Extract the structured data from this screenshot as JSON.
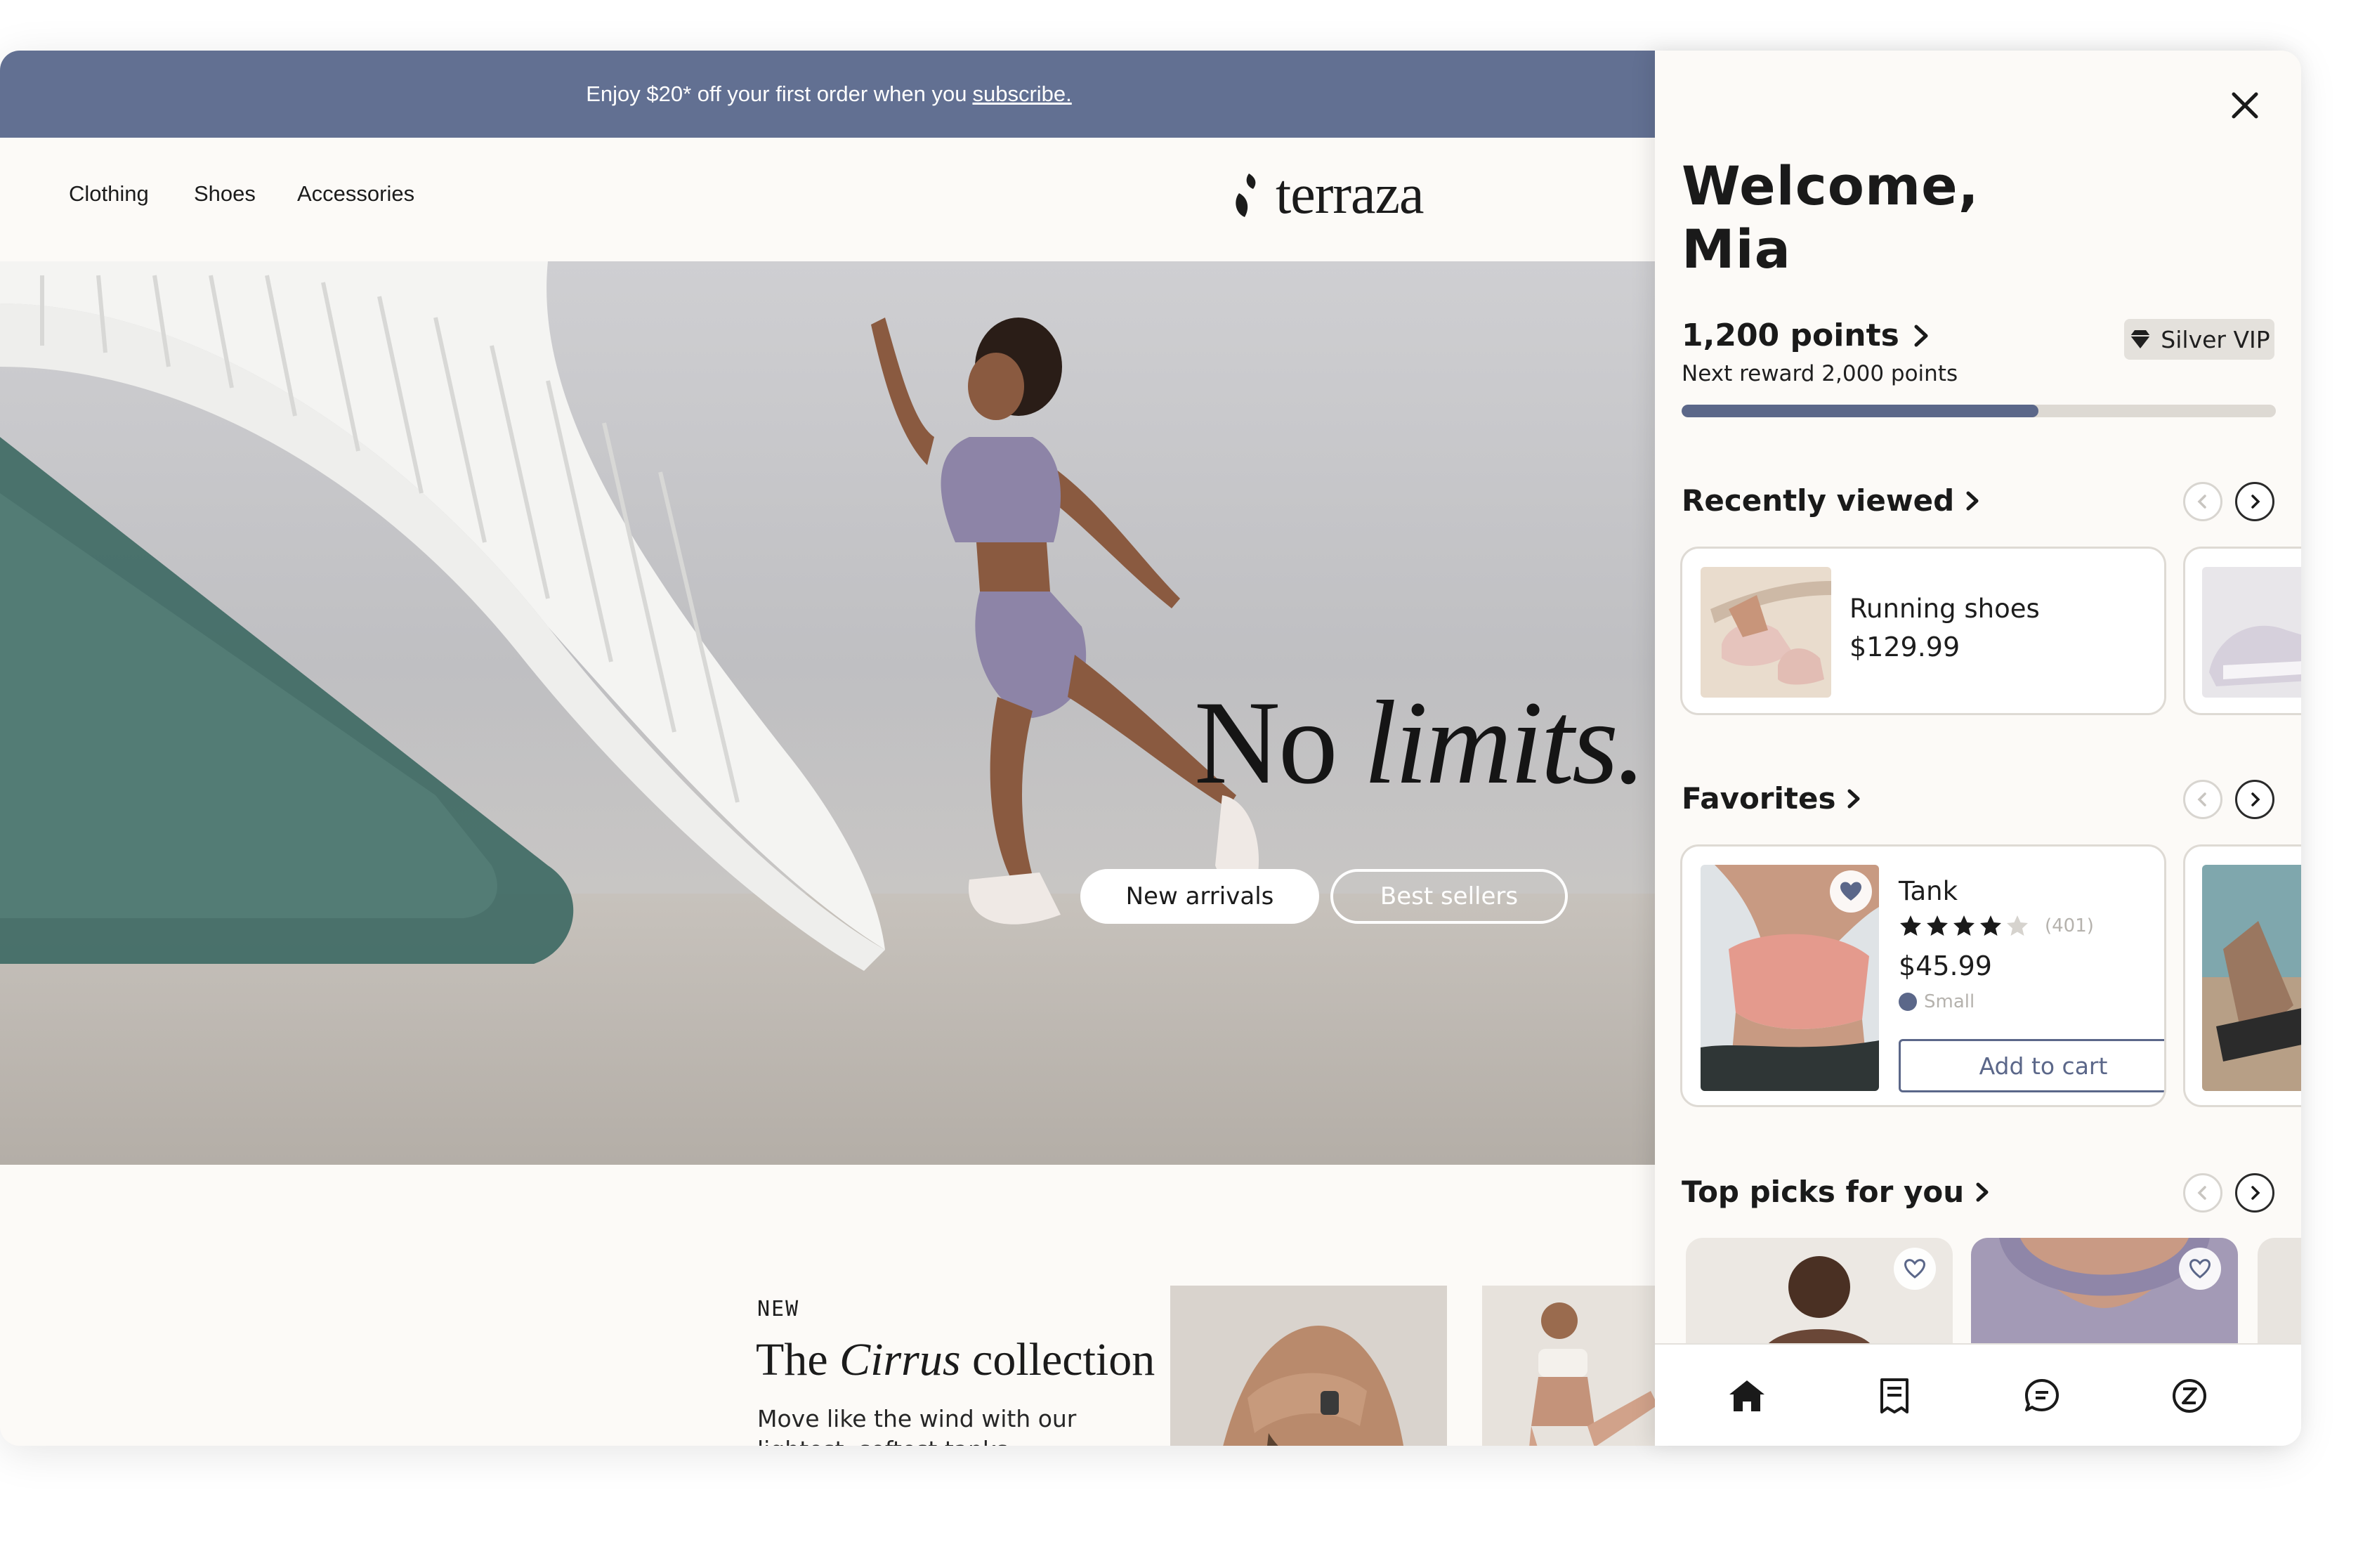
{
  "promo": {
    "text": "Enjoy $20* off your first order when you",
    "link": "subscribe."
  },
  "nav": {
    "items": [
      "Clothing",
      "Shoes",
      "Accessories"
    ],
    "brand": "terraza"
  },
  "hero": {
    "title_plain": "No",
    "title_italic": "limits.",
    "buttons": {
      "primary": "New arrivals",
      "secondary": "Best sellers"
    }
  },
  "collection": {
    "eyebrow": "NEW",
    "title_pre": "The",
    "title_italic": "Cirrus",
    "title_post": "collection",
    "description": "Move like the wind with our lightest, softest tanks, leggings, and sneakers."
  },
  "panel": {
    "welcome_line1": "Welcome,",
    "welcome_line2": "Mia",
    "points_label": "1,200 points",
    "tier": "Silver VIP",
    "next_reward": "Next reward 2,000 points",
    "progress_fraction": 0.6,
    "recently_viewed": {
      "title": "Recently viewed",
      "item": {
        "name": "Running shoes",
        "price": "$129.99"
      }
    },
    "favorites": {
      "title": "Favorites",
      "item": {
        "name": "Tank",
        "rating": 4,
        "rating_max": 5,
        "reviews": "(401)",
        "price": "$45.99",
        "size": "Small",
        "cta": "Add to cart"
      }
    },
    "top_picks": {
      "title": "Top picks for you"
    },
    "bottom_nav": [
      "home-icon",
      "receipt-icon",
      "chat-icon",
      "brand-z-icon"
    ]
  },
  "colors": {
    "accent": "#627092",
    "progress": "#5b6789",
    "panel_bg": "#fcfaf7"
  }
}
